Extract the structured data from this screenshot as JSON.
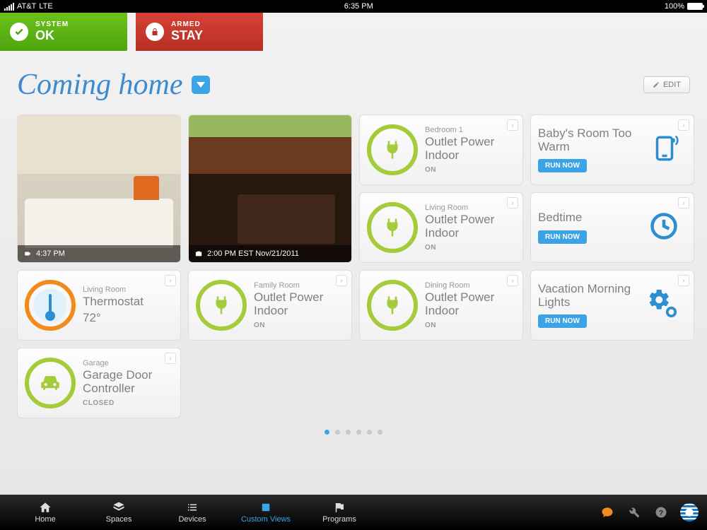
{
  "statusbar": {
    "carrier": "AT&T",
    "network": "LTE",
    "time": "6:35 PM",
    "battery_pct": "100%"
  },
  "banners": {
    "system": {
      "label": "SYSTEM",
      "status": "OK"
    },
    "armed": {
      "label": "ARMED",
      "status": "STAY"
    }
  },
  "view_title": "Coming home",
  "edit_label": "EDIT",
  "cameras": {
    "living": {
      "caption": "4:37 PM"
    },
    "kitchen": {
      "caption": "2:00 PM EST Nov/21/2011"
    }
  },
  "tiles": {
    "thermostat": {
      "room": "Living Room",
      "title": "Thermostat",
      "value": "72°"
    },
    "garage": {
      "room": "Garage",
      "title": "Garage Door Controller",
      "status": "CLOSED"
    },
    "outlet_family": {
      "room": "Family Room",
      "title": "Outlet Power Indoor",
      "status": "ON"
    },
    "outlet_bedroom1": {
      "room": "Bedroom 1",
      "title": "Outlet Power Indoor",
      "status": "ON"
    },
    "outlet_living": {
      "room": "Living Room",
      "title": "Outlet Power Indoor",
      "status": "ON"
    },
    "outlet_dining": {
      "room": "Dining Room",
      "title": "Outlet Power Indoor",
      "status": "ON"
    }
  },
  "programs": {
    "baby": {
      "title": "Baby's Room Too Warm",
      "action": "RUN NOW"
    },
    "bedtime": {
      "title": "Bedtime",
      "action": "RUN NOW"
    },
    "vacation": {
      "title": "Vacation Morning Lights",
      "action": "RUN NOW"
    }
  },
  "nav": {
    "home": "Home",
    "spaces": "Spaces",
    "devices": "Devices",
    "custom": "Custom Views",
    "programs": "Programs"
  }
}
